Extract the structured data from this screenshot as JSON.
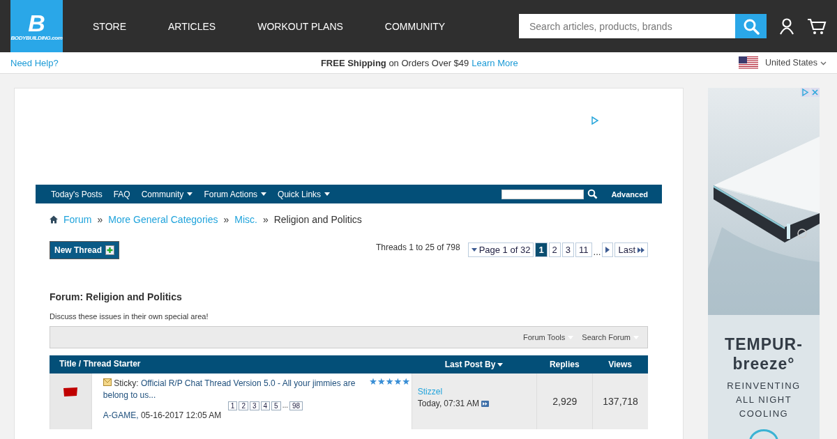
{
  "logo": {
    "mark": "B",
    "wordmark": "BODYBUILDING.com"
  },
  "main_nav": [
    "STORE",
    "ARTICLES",
    "WORKOUT PLANS",
    "COMMUNITY"
  ],
  "search": {
    "placeholder": "Search articles, products, brands"
  },
  "promo_bar": {
    "help": "Need Help?",
    "shipping": "**FREE Shipping** on Orders Over $49",
    "learn_more": "Learn More",
    "country": "United States"
  },
  "forum_nav": {
    "items": [
      {
        "label": "Today's Posts",
        "dropdown": false
      },
      {
        "label": "FAQ",
        "dropdown": false
      },
      {
        "label": "Community",
        "dropdown": true
      },
      {
        "label": "Forum Actions",
        "dropdown": true
      },
      {
        "label": "Quick Links",
        "dropdown": true
      }
    ],
    "advanced": "Advanced"
  },
  "breadcrumb": [
    "Forum",
    "More General Categories",
    "Misc.",
    "Religion and Politics"
  ],
  "breadcrumb_separator": "»",
  "new_thread": "New Thread",
  "threads_count": "Threads 1 to 25 of 798",
  "pagination": {
    "page_of": "Page 1 of 32",
    "pages": [
      {
        "label": "1",
        "selected": true
      },
      {
        "label": "2",
        "selected": false
      },
      {
        "label": "3",
        "selected": false
      },
      {
        "label": "11",
        "selected": false
      }
    ],
    "ellipsis": "...",
    "last": "Last"
  },
  "forum": {
    "title": "Forum: Religion and Politics",
    "description": "Discuss these issues in their own special area!",
    "tools": [
      "Forum Tools",
      "Search Forum"
    ]
  },
  "table": {
    "columns": [
      "Title / Thread Starter",
      "Last Post By",
      "Replies",
      "Views"
    ],
    "rows": [
      {
        "prefix": "Sticky:",
        "title": "Official R/P Chat Thread Version 5.0 - All your jimmies are belong to us...",
        "stars": 5,
        "pages": [
          "1",
          "2",
          "3",
          "4",
          "5"
        ],
        "pages_ellipsis": "...",
        "last_page": "98",
        "starter": "A-GAME,",
        "started": "05-16-2017 12:05 AM",
        "last_poster": "Stizzel",
        "last_day": "Today,",
        "last_time": "07:31 AM",
        "replies": "2,929",
        "views": "137,718"
      }
    ]
  },
  "ad": {
    "headline": "TEMPUR-",
    "headline_2": "breeze°",
    "tagline": [
      "REINVENTING",
      "ALL NIGHT",
      "COOLING"
    ]
  }
}
